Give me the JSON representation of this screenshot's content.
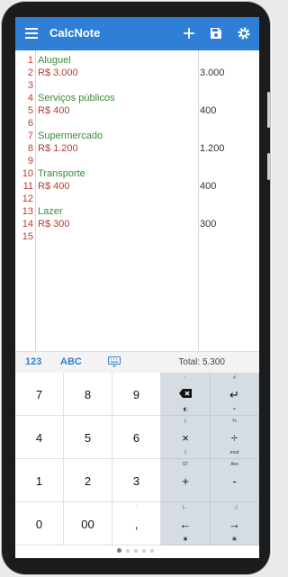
{
  "app": {
    "title": "CalcNote",
    "actions": [
      "add-icon",
      "save-icon",
      "settings-icon"
    ]
  },
  "editor": {
    "line_numbers": [
      "1",
      "2",
      "3",
      "4",
      "5",
      "6",
      "7",
      "8",
      "9",
      "10",
      "11",
      "12",
      "13",
      "14",
      "15"
    ],
    "lines": [
      {
        "n": 1,
        "text": "Aluguel",
        "kind": "heading"
      },
      {
        "n": 2,
        "text": "R$ 3.000",
        "kind": "value"
      },
      {
        "n": 4,
        "text": "Serviços públicos",
        "kind": "heading"
      },
      {
        "n": 5,
        "text": "R$ 400",
        "kind": "value"
      },
      {
        "n": 7,
        "text": "Supermercado",
        "kind": "heading"
      },
      {
        "n": 8,
        "text": "R$ 1.200",
        "kind": "value"
      },
      {
        "n": 10,
        "text": "Transporte",
        "kind": "heading"
      },
      {
        "n": 11,
        "text": "R$ 400",
        "kind": "value"
      },
      {
        "n": 13,
        "text": "Lazer",
        "kind": "heading"
      },
      {
        "n": 14,
        "text": "R$ 300",
        "kind": "value"
      }
    ],
    "results": [
      {
        "n": 2,
        "text": "3.000"
      },
      {
        "n": 5,
        "text": "400"
      },
      {
        "n": 8,
        "text": "1.200"
      },
      {
        "n": 11,
        "text": "400"
      },
      {
        "n": 14,
        "text": "300"
      }
    ]
  },
  "keyboard_bar": {
    "tab_numeric": "123",
    "tab_alpha": "ABC",
    "keyboard_icon": "keyboard-icon",
    "total": "Total: 5.300"
  },
  "keyboard": {
    "keys": [
      [
        "7",
        "8",
        "9"
      ],
      [
        "4",
        "5",
        "6"
      ],
      [
        "1",
        "2",
        "3"
      ],
      [
        "0",
        "00",
        ","
      ]
    ],
    "ops": [
      {
        "main": "backspace-icon",
        "top": "↑",
        "bot": "◧"
      },
      {
        "main": "↵",
        "top": "#",
        "bot": "="
      },
      {
        "main": "×",
        "top": "(",
        "bot": ")"
      },
      {
        "main": "÷",
        "top": "%",
        "bot": "mod"
      },
      {
        "main": "+",
        "top": "ST",
        "bot": ""
      },
      {
        "main": "-",
        "top": "Ans",
        "bot": ""
      },
      {
        "main": "←",
        "top": "|←",
        "bot": "▣"
      },
      {
        "main": "→",
        "top": "→|",
        "bot": "▣"
      }
    ],
    "comma_top": "`"
  },
  "colors": {
    "appbar": "#2f7fd6",
    "heading_text": "#3a8a3a",
    "value_text": "#b93a2e",
    "line_number": "#c0392b",
    "op_keys": "#d6dce3"
  }
}
